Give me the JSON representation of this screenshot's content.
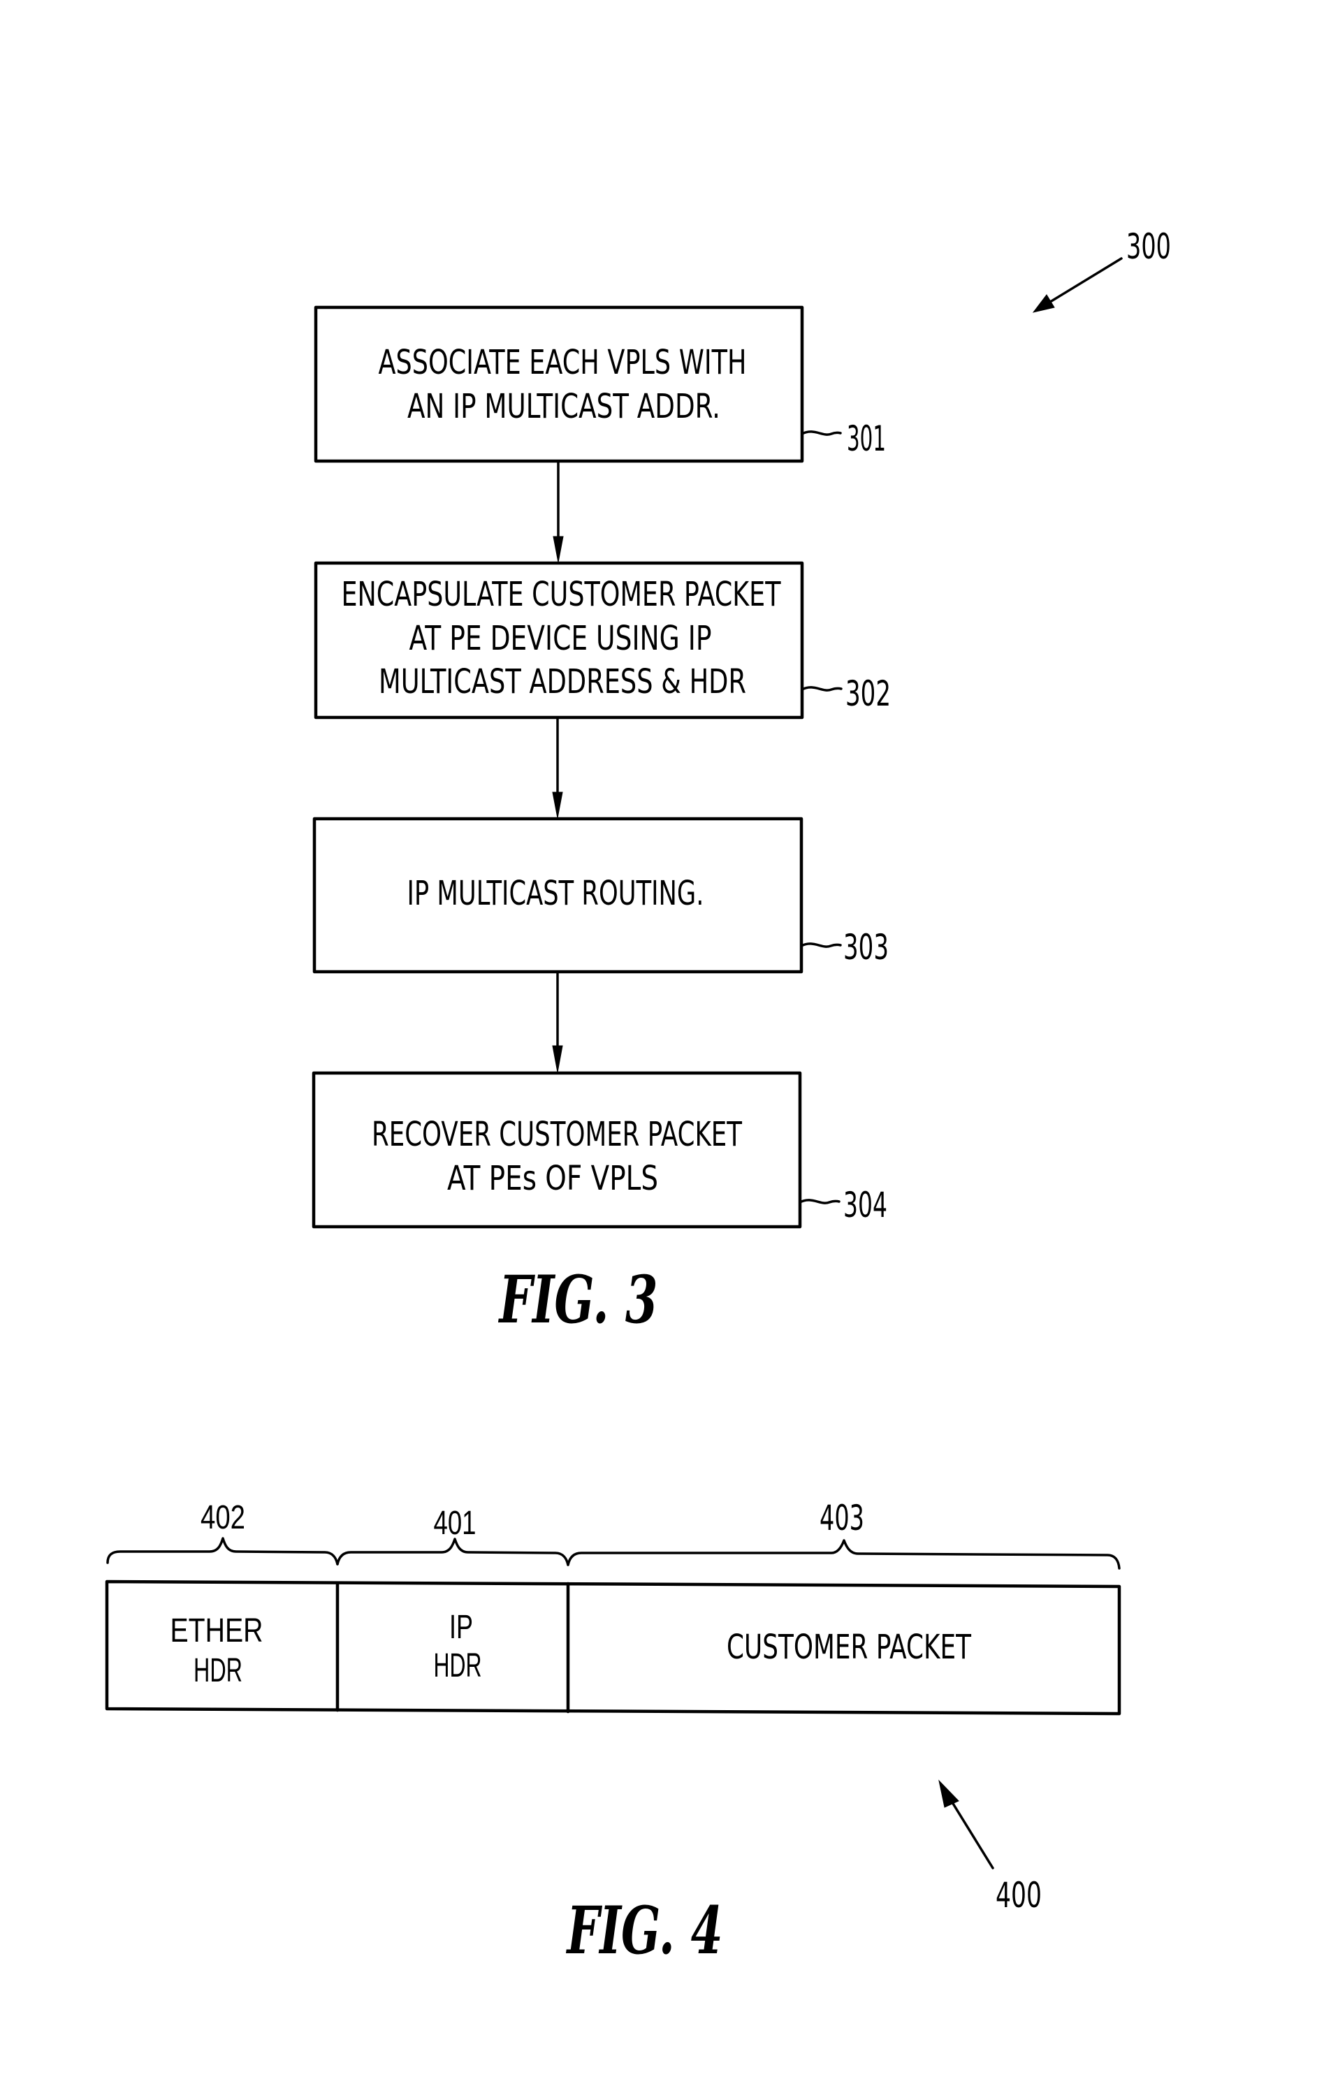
{
  "figure3": {
    "reference": "300",
    "caption": "FIG. 3",
    "steps": [
      {
        "id": "301",
        "lines": [
          "ASSOCIATE EACH VPLS WITH",
          "AN IP MULTICAST ADDR."
        ]
      },
      {
        "id": "302",
        "lines": [
          "ENCAPSULATE CUSTOMER PACKET",
          "AT PE DEVICE USING IP",
          "MULTICAST ADDRESS & HDR"
        ]
      },
      {
        "id": "303",
        "lines": [
          "IP MULTICAST ROUTING."
        ]
      },
      {
        "id": "304",
        "lines": [
          "RECOVER CUSTOMER PACKET",
          "AT PEs OF VPLS"
        ]
      }
    ]
  },
  "figure4": {
    "reference": "400",
    "caption": "FIG. 4",
    "fields": [
      {
        "id": "402",
        "lines": [
          "ETHER",
          "HDR"
        ]
      },
      {
        "id": "401",
        "lines": [
          "IP",
          "HDR"
        ]
      },
      {
        "id": "403",
        "lines": [
          "CUSTOMER PACKET"
        ]
      }
    ]
  }
}
